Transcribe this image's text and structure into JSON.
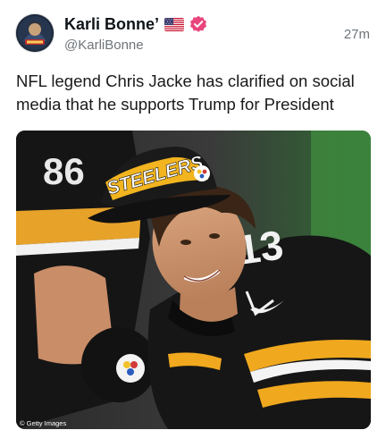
{
  "author": {
    "display_name": "Karli Bonne’",
    "handle": "@KarliBonne",
    "avatar_icon": "avatar-image",
    "flag_icon": "us-flag-icon",
    "verified_icon": "verified-badge-icon",
    "verified_color": "#e8467c"
  },
  "post": {
    "timestamp": "27m",
    "text": "NFL legend Chris Jacke has clarified on social media that he supports Trump for President"
  },
  "media": {
    "cap_text": "STEELERS",
    "jersey_number": "13",
    "background_jersey_number": "86",
    "credit": "© Getty Images"
  },
  "colors": {
    "text": "#0f1419",
    "secondary": "#6e7479",
    "jersey_black": "#1a1a1a",
    "jersey_gold": "#f0a81e"
  }
}
